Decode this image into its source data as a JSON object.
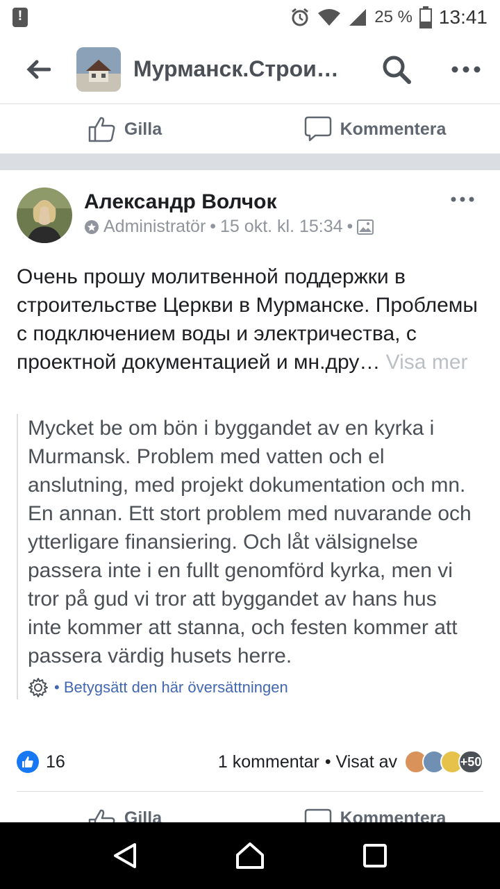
{
  "status_bar": {
    "battery": "25 %",
    "time": "13:41"
  },
  "app_bar": {
    "title": "Мурманск.Строи…",
    "icons": [
      "back-arrow-icon",
      "search-icon",
      "more-icon"
    ]
  },
  "prev_post_actions": {
    "like_label": "Gilla",
    "comment_label": "Kommentera"
  },
  "post": {
    "author": "Александр Волчок",
    "role": "Administratör",
    "separator": "•",
    "timestamp": "15 okt. kl. 15:34",
    "text": "Очень прошу молитвенной поддержки в строительстве Церкви в Мурманске. Проблемы с подключением воды и электричества, с проектной документацией и мн.дру…",
    "see_more": "Visa mer",
    "translation": "Mycket be om bön i byggandet av en kyrka i Murmansk. Problem med vatten och el anslutning, med projekt dokumentation och mn. En annan. Ett stort problem med nuvarande och ytterligare finansiering. Och låt välsignelse passera inte i en fullt genomförd kyrka, men vi tror på gud vi tror att byggandet av hans hus inte kommer att stanna, och festen kommer att passera värdig husets herre.",
    "rate_translation": "• Betygsätt den här översättningen",
    "like_count": "16",
    "comments": "1 kommentar",
    "seen_by": "• Visat av",
    "seen_more": "+50"
  },
  "post_actions": {
    "like_label": "Gilla",
    "comment_label": "Kommentera"
  },
  "colors": {
    "brand_blue": "#1877f2",
    "link_blue": "#4267b2",
    "divider": "#dadde1"
  }
}
